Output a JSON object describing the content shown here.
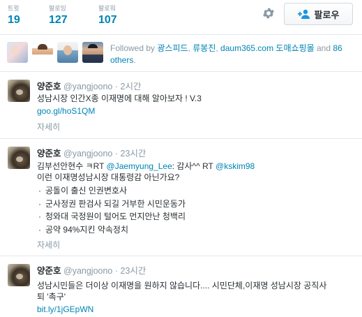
{
  "stats": {
    "tweets_label": "트윗",
    "tweets_value": "19",
    "following_label": "팔로잉",
    "following_value": "127",
    "followers_label": "팔로워",
    "followers_value": "107"
  },
  "follow_button": {
    "label": "팔로우",
    "icon": "add-user-icon"
  },
  "settings": {
    "icon": "gear-icon"
  },
  "followed_by": {
    "prefix": "Followed by",
    "users": [
      "광스피드",
      "류봉진",
      "daum365.com 도매쇼핑몰"
    ],
    "sep1": ",",
    "sep2": ",",
    "and_text": "and",
    "others_text": "86 others",
    "end": "."
  },
  "tweets": [
    {
      "name": "양준호",
      "handle": "@yangjoono",
      "dot": "·",
      "time": "2시간",
      "text": "성남시장 인간X종 이재명에 대해 알아보자 ! V.3",
      "link": "goo.gl/hoS1QM",
      "detail": "자세히"
    },
    {
      "name": "양준호",
      "handle": "@yangjoono",
      "dot": "·",
      "time": "23시간",
      "line1_prefix": "김부선안현수 ㅋRT ",
      "line1_mention1": "@Jaemyung_Lee",
      "line1_mid": ": 감사^^ RT ",
      "line1_mention2": "@kskim98",
      "line2": "이런 이재명성남시장 대통령감 아닌가요?",
      "bullets": [
        "공돌이 출신 인권변호사",
        "군사정권 판검사 되길 거부한 시민운동가",
        "청와대 국정원이 털어도 먼지안난 청백리",
        "공약 94%지킨 약속정치"
      ],
      "detail": "자세히"
    },
    {
      "name": "양준호",
      "handle": "@yangjoono",
      "dot": "·",
      "time": "23시간",
      "text_line1": "성남시민들은 더이상 이재명을 원하지 않습니다.... 시민단체,이재명 성남시장 공직사",
      "text_line2": "퇴 '촉구'",
      "link": "bit.ly/1jGEpWN"
    }
  ]
}
